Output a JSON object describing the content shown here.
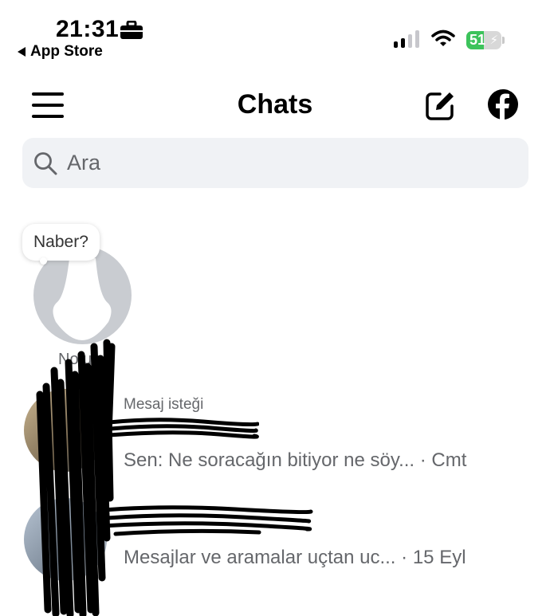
{
  "status_bar": {
    "time": "21:31",
    "back_app": "App Store",
    "battery": "51",
    "battery_level_percent": 51
  },
  "header": {
    "title": "Chats"
  },
  "search": {
    "placeholder": "Ara"
  },
  "note": {
    "bubble_text": "Naber?",
    "label": "Notun"
  },
  "chats": [
    {
      "tag": "Mesaj isteği",
      "preview": "Sen: Ne soracağın bitiyor ne söy...",
      "time": "Cmt"
    },
    {
      "preview": "Mesajlar ve aramalar uçtan uc...",
      "time": "15 Eyl"
    }
  ],
  "colors": {
    "accent_battery": "#3cc35b",
    "search_bg": "#f0f2f5",
    "secondary_text": "#65676b"
  }
}
